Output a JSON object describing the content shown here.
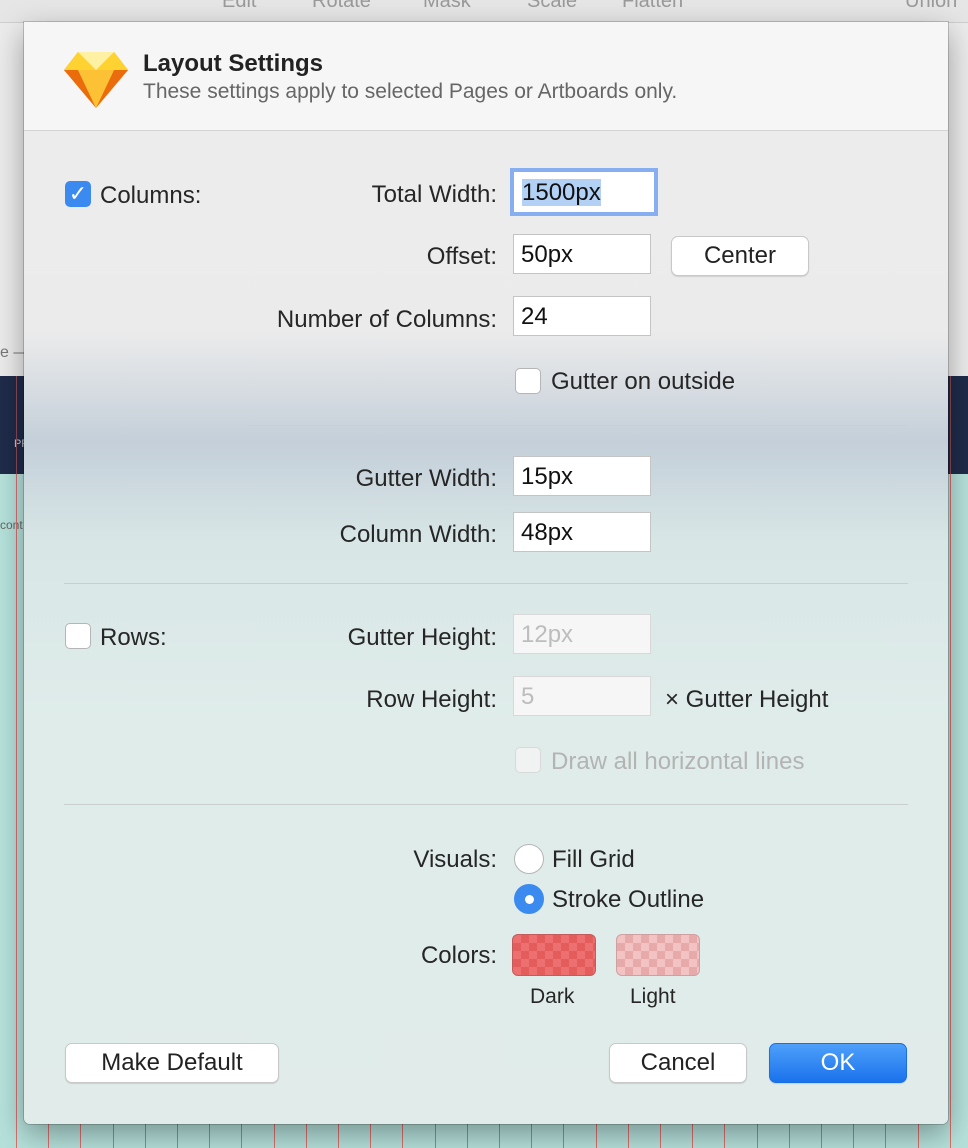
{
  "background": {
    "toolbar_labels": [
      "Edit",
      "Rotate",
      "Mask",
      "Scale",
      "Flatten",
      "Union"
    ],
    "page_label": "e —",
    "artboard_header_text": "PR",
    "artboard_text": "cont",
    "colors": {
      "canvas_dark": "#1f2b4a",
      "canvas_mint": "#b6e1db",
      "grid_line": "#d67070"
    }
  },
  "dialog": {
    "logo_icon": "sketch-diamond-icon",
    "title": "Layout Settings",
    "subtitle": "These settings apply to selected Pages or Artboards only."
  },
  "columns": {
    "enabled": true,
    "label": "Columns:",
    "total_width_label": "Total Width:",
    "total_width_value": "1500px",
    "offset_label": "Offset:",
    "offset_value": "50px",
    "center_button": "Center",
    "number_label": "Number of Columns:",
    "number_value": "24",
    "gutter_outside_label": "Gutter on outside",
    "gutter_outside_checked": false,
    "gutter_width_label": "Gutter Width:",
    "gutter_width_value": "15px",
    "column_width_label": "Column Width:",
    "column_width_value": "48px"
  },
  "rows": {
    "enabled": false,
    "label": "Rows:",
    "gutter_height_label": "Gutter Height:",
    "gutter_height_placeholder": "12px",
    "row_height_label": "Row Height:",
    "row_height_placeholder": "5",
    "row_height_suffix": "× Gutter Height",
    "draw_lines_label": "Draw all horizontal lines",
    "draw_lines_checked": false
  },
  "visuals": {
    "label": "Visuals:",
    "options": [
      "Fill Grid",
      "Stroke Outline"
    ],
    "selected": "Stroke Outline"
  },
  "colors": {
    "label": "Colors:",
    "dark_label": "Dark",
    "light_label": "Light",
    "dark_hex": "#ee6f6f",
    "light_hex": "#f3c2c2"
  },
  "buttons": {
    "make_default": "Make Default",
    "cancel": "Cancel",
    "ok": "OK"
  }
}
